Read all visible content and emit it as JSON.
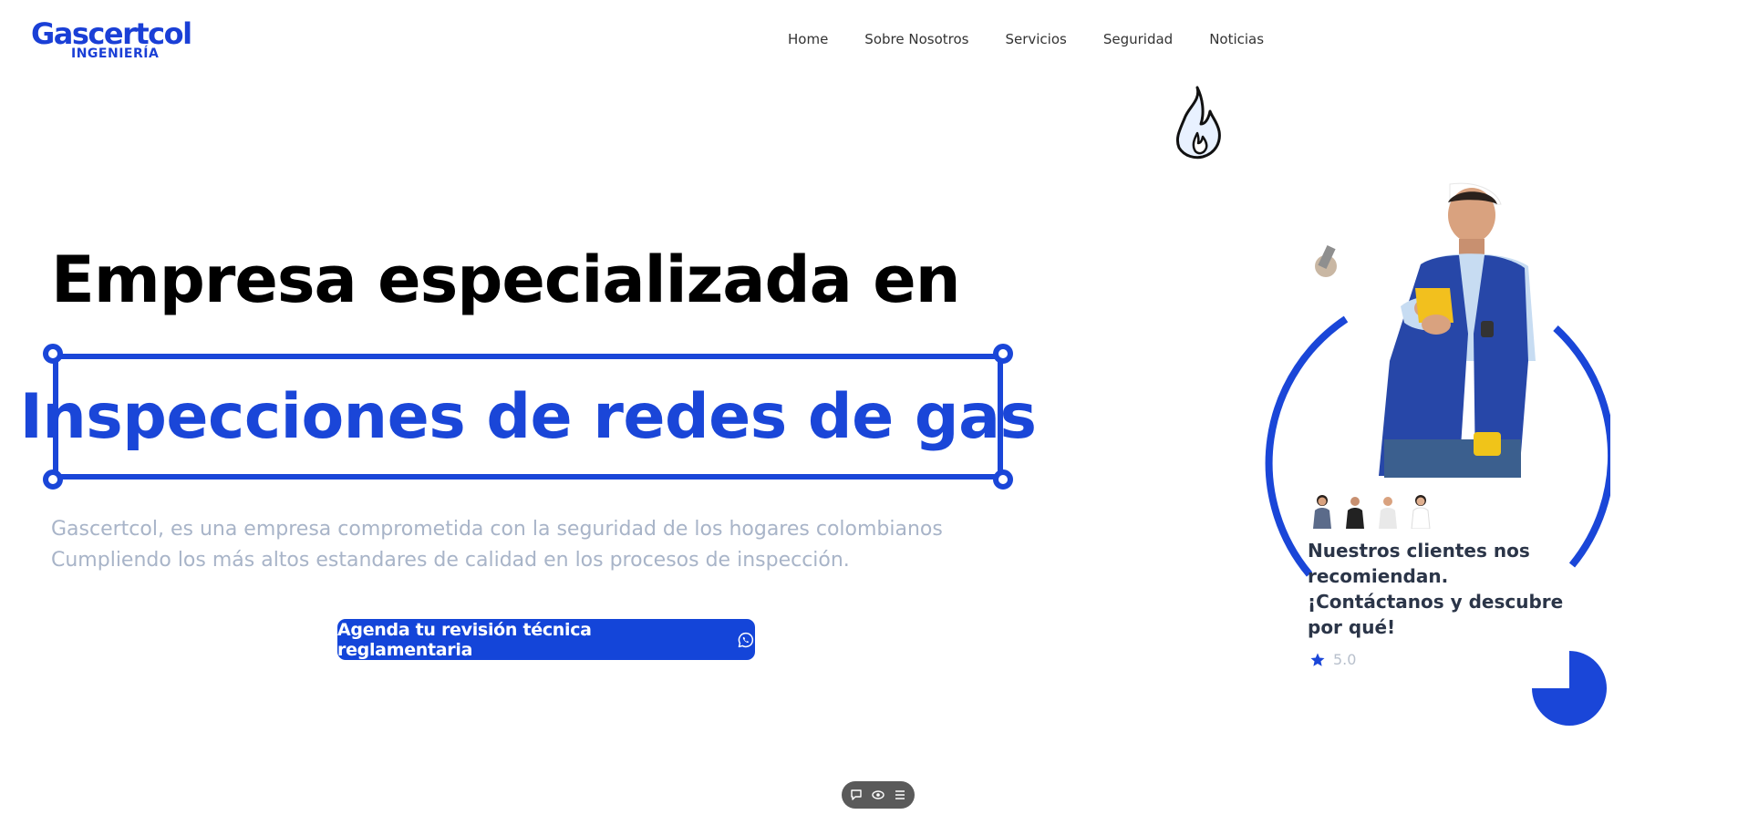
{
  "brand": {
    "name": "Gascertcol",
    "tagline": "INGENIERÍA",
    "primary_color": "#1a46d8"
  },
  "nav": {
    "items": [
      {
        "label": "Home"
      },
      {
        "label": "Sobre Nosotros"
      },
      {
        "label": "Servicios"
      },
      {
        "label": "Seguridad"
      },
      {
        "label": "Noticias"
      }
    ]
  },
  "hero": {
    "headline": "Empresa especializada en",
    "highlight": "Inspecciones de redes de gas",
    "description": "Gascertcol, es una empresa comprometida con la seguridad de los hogares colombianos Cumpliendo los más altos estandares de calidad en los procesos de inspección.",
    "cta_label": "Agenda tu revisión técnica reglamentaria",
    "cta_icon": "whatsapp-icon"
  },
  "testimonial": {
    "text": "Nuestros clientes nos recomiendan. ¡Contáctanos y descubre por qué!",
    "rating": "5.0",
    "rating_icon": "star-icon"
  },
  "toolbar": {
    "icons": [
      "chat-icon",
      "eye-icon",
      "settings-icon"
    ]
  }
}
